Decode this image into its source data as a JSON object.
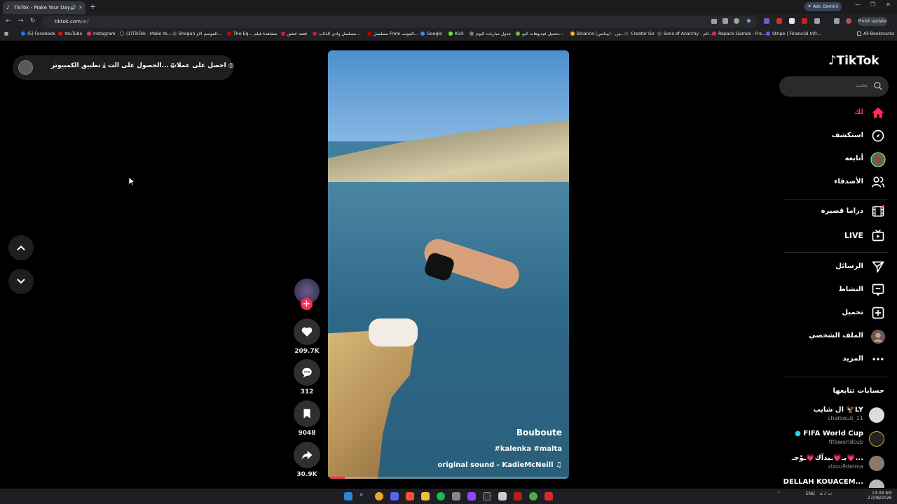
{
  "browser": {
    "tab_title": "TikTok - Make Your Day",
    "url_domain": "tiktok.com",
    "url_path": "/ar/",
    "gemini_label": "Ask Gemini",
    "finish_update_label": "Finish update",
    "all_bookmarks_label": "All Bookmarks",
    "bookmarks": [
      "(5) Facebook",
      "YouTube",
      "Instagram",
      "(1)TikTok - Make Yo...",
      "Shogun الموسم الاو...",
      "The Eq... مشاهدة فيلم",
      "قصة عشق",
      "مسلسل وادي الذئاب...",
      "مسلسل From الموسـ...",
      "Google",
      "Kick",
      "جدول مباريات اليوم",
      "تحميل فيديوهات اليو...",
      "Binance (بينانس) - مِن...",
      "Creator Go",
      "Sons of Anarchy - الم...",
      "Repack-Games - Fre...",
      "Stripe | Financial Infr..."
    ]
  },
  "topbar": {
    "coins_label": "احصل على عملات",
    "get_app_label": "الحصول على الت...",
    "desktop_app_label": "تطبيق الكمبيوتر"
  },
  "video": {
    "author": "Bouboute",
    "tags": "#kalenka #malta",
    "sound": "original sound - KadieMcNeill",
    "progress": 0.07
  },
  "actions": {
    "likes": "209.7K",
    "comments": "312",
    "saves": "9048",
    "shares": "30.9K"
  },
  "sidebar": {
    "logo": "TikTok",
    "search_placeholder": "بحث",
    "nav": [
      {
        "label": "لك",
        "icon": "home-icon"
      },
      {
        "label": "استكشف",
        "icon": "compass-icon"
      },
      {
        "label": "أتابعه",
        "icon": "following-avatar-icon"
      },
      {
        "label": "الأصدقاء",
        "icon": "friends-icon"
      },
      {
        "label": "دراما قصيرة",
        "icon": "film-icon"
      },
      {
        "label": "LIVE",
        "icon": "live-tv-icon"
      },
      {
        "label": "الرسائل",
        "icon": "send-icon"
      },
      {
        "label": "النشاط",
        "icon": "activity-icon"
      },
      {
        "label": "تحميل",
        "icon": "upload-icon"
      },
      {
        "label": "الملف الشخصي",
        "icon": "profile-avatar-icon"
      },
      {
        "label": "المزيد",
        "icon": "more-icon"
      }
    ],
    "following_heading": "حسابات تتابعها",
    "following": [
      {
        "name": "ال شايب 🦅LY",
        "user": "chaiboub_11"
      },
      {
        "name": "FIFA World Cup",
        "user": "fifaworldcup"
      },
      {
        "name": "بـ💗ـيدآك💗ـوْجـ💗...",
        "user": "zizou9delma"
      },
      {
        "name": "DELLAH KOUACEM...",
        "user": ""
      }
    ]
  },
  "taskbar": {
    "language": "ENG",
    "time": "13:09 AM",
    "date": "27/08/2026"
  },
  "colors": {
    "accent": "#fe2c55",
    "bg": "#000000"
  }
}
